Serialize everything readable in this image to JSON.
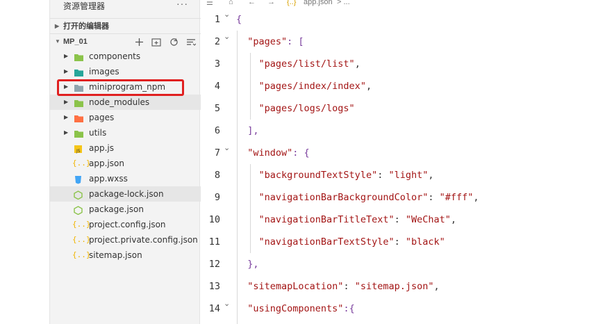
{
  "sidebar": {
    "title": "资源管理器",
    "more": "···",
    "open_editors": "打开的编辑器",
    "project": "MP_01",
    "items": [
      {
        "label": "components",
        "icon": "folder-components-icon",
        "color": "#8bc34a",
        "caret": "▸"
      },
      {
        "label": "images",
        "icon": "folder-images-icon",
        "color": "#26a69a",
        "caret": "▸"
      },
      {
        "label": "miniprogram_npm",
        "icon": "folder-icon",
        "color": "#90a4ae",
        "caret": "▸"
      },
      {
        "label": "node_modules",
        "icon": "folder-node-icon",
        "color": "#8bc34a",
        "caret": "▸"
      },
      {
        "label": "pages",
        "icon": "folder-pages-icon",
        "color": "#ff7043",
        "caret": "▸"
      },
      {
        "label": "utils",
        "icon": "folder-utils-icon",
        "color": "#8bc34a",
        "caret": "▸"
      },
      {
        "label": "app.js",
        "icon": "js-file-icon",
        "color": "#f5c518",
        "caret": ""
      },
      {
        "label": "app.json",
        "icon": "json-file-icon",
        "color": "#f0b400",
        "caret": ""
      },
      {
        "label": "app.wxss",
        "icon": "wxss-file-icon",
        "color": "#42a5f5",
        "caret": ""
      },
      {
        "label": "package-lock.json",
        "icon": "npm-file-icon",
        "color": "#8bc34a",
        "caret": ""
      },
      {
        "label": "package.json",
        "icon": "npm-file-icon",
        "color": "#8bc34a",
        "caret": ""
      },
      {
        "label": "project.config.json",
        "icon": "json-file-icon",
        "color": "#f0b400",
        "caret": ""
      },
      {
        "label": "project.private.config.json",
        "icon": "json-file-icon",
        "color": "#f0b400",
        "caret": ""
      },
      {
        "label": "sitemap.json",
        "icon": "json-file-icon",
        "color": "#f0b400",
        "caret": ""
      }
    ]
  },
  "editor": {
    "breadcrumb": "app.json",
    "breadcrumb_sep": "> ...",
    "breadcrumb_icon": "{..}",
    "lines": [
      {
        "n": "1",
        "fold": true
      },
      {
        "n": "2",
        "fold": true
      },
      {
        "n": "3",
        "fold": false
      },
      {
        "n": "4",
        "fold": false
      },
      {
        "n": "5",
        "fold": false
      },
      {
        "n": "6",
        "fold": false
      },
      {
        "n": "7",
        "fold": true
      },
      {
        "n": "8",
        "fold": false
      },
      {
        "n": "9",
        "fold": false
      },
      {
        "n": "10",
        "fold": false
      },
      {
        "n": "11",
        "fold": false
      },
      {
        "n": "12",
        "fold": false
      },
      {
        "n": "13",
        "fold": false
      },
      {
        "n": "14",
        "fold": true
      }
    ],
    "code": {
      "l1": "{",
      "l2_key": "\"pages\"",
      "l2_rest": ": [",
      "l3": "\"pages/list/list\"",
      "l4": "\"pages/index/index\"",
      "l5": "\"pages/logs/logs\"",
      "l6": "],",
      "l7_key": "\"window\"",
      "l7_rest": ": {",
      "l8_key": "\"backgroundTextStyle\"",
      "l8_val": "\"light\"",
      "l9_key": "\"navigationBarBackgroundColor\"",
      "l9_val": "\"#fff\"",
      "l10_key": "\"navigationBarTitleText\"",
      "l10_val": "\"WeChat\"",
      "l11_key": "\"navigationBarTextStyle\"",
      "l11_val": "\"black\"",
      "l12": "},",
      "l13_key": "\"sitemapLocation\"",
      "l13_val": "\"sitemap.json\"",
      "l14_key": "\"usingComponents\"",
      "l14_rest": ":{"
    }
  },
  "colors": {
    "highlight_box": "#e02020",
    "string": "#a31515",
    "bracket": "#7a3e9d"
  }
}
